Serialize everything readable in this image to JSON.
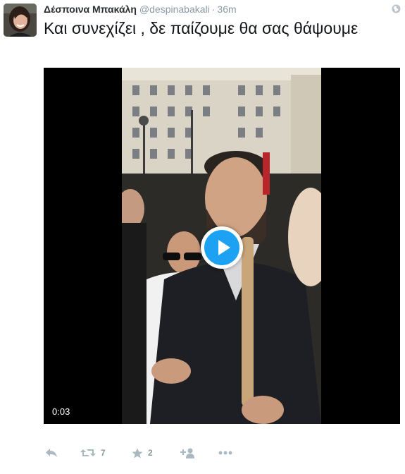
{
  "tweet": {
    "author_name": "Δέσποινα Μπακάλη",
    "handle": "@despinabakali",
    "separator": "·",
    "time": "36m",
    "text": "Και συνεχίζει , δε παίζουμε θα σας θάψουμε"
  },
  "video": {
    "duration": "0:03",
    "play_icon": "play-icon"
  },
  "actions": {
    "reply_icon": "reply-icon",
    "retweet_icon": "retweet-icon",
    "retweet_count": "7",
    "favorite_icon": "star-icon",
    "favorite_count": "2",
    "follow_icon": "follow-icon",
    "more_icon": "more-icon"
  },
  "colors": {
    "accent": "#1da1f2",
    "muted": "#8899a6",
    "text": "#14171a"
  }
}
